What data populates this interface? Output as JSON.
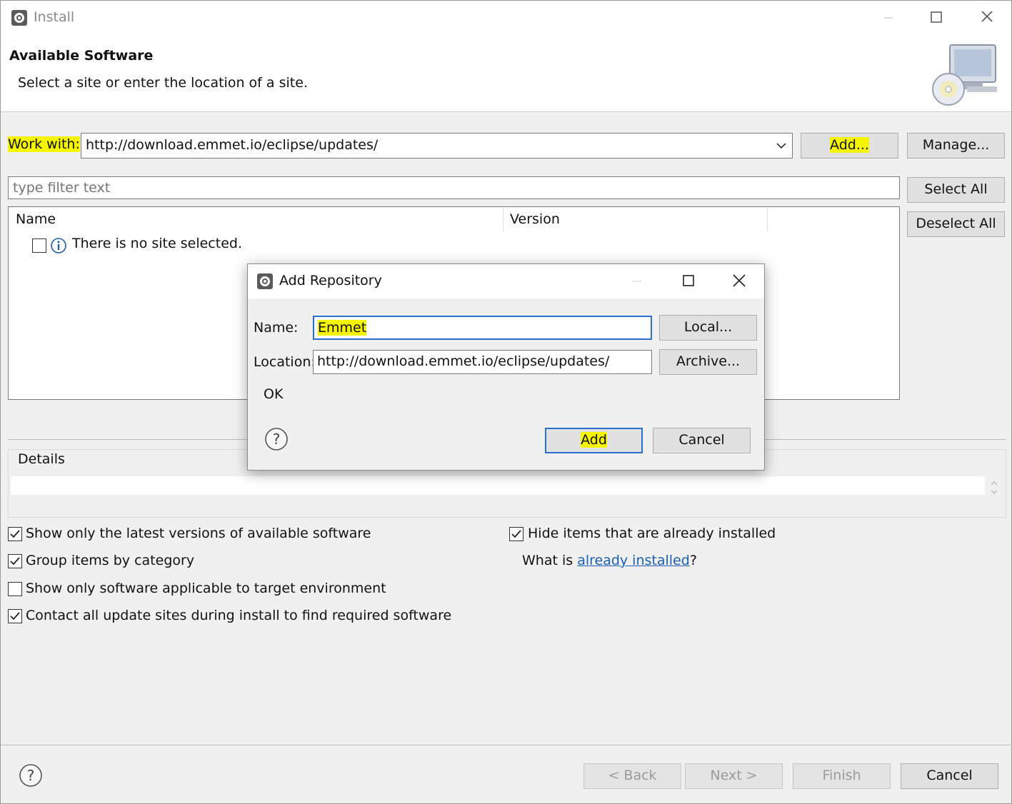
{
  "window": {
    "title": "Install"
  },
  "banner": {
    "title": "Available Software",
    "description": "Select a site or enter the location of a site."
  },
  "work_with": {
    "label": "Work with:",
    "value": "http://download.emmet.io/eclipse/updates/",
    "add_label": "Add...",
    "manage_label": "Manage..."
  },
  "filter": {
    "placeholder": "type filter text",
    "select_all_label": "Select All",
    "deselect_all_label": "Deselect All"
  },
  "tree": {
    "columns": [
      "Name",
      "Version"
    ],
    "empty_message": "There is no site selected."
  },
  "details": {
    "label": "Details"
  },
  "options": {
    "show_latest": {
      "label": "Show only the latest versions of available software",
      "checked": true
    },
    "group_by_category": {
      "label": "Group items by category",
      "checked": true
    },
    "show_applicable": {
      "label": "Show only software applicable to target environment",
      "checked": false
    },
    "contact_all_sites": {
      "label": "Contact all update sites during install to find required software",
      "checked": true
    },
    "hide_installed": {
      "label": "Hide items that are already installed",
      "checked": true
    },
    "what_is_prefix": "What is ",
    "already_installed_link": "already installed",
    "what_is_suffix": "?"
  },
  "footer": {
    "back_label": "< Back",
    "next_label": "Next >",
    "finish_label": "Finish",
    "cancel_label": "Cancel"
  },
  "add_repository": {
    "title": "Add Repository",
    "name_label": "Name:",
    "name_value": "Emmet",
    "location_label": "Location:",
    "location_value": "http://download.emmet.io/eclipse/updates/",
    "local_label": "Local...",
    "archive_label": "Archive...",
    "status": "OK",
    "add_label": "Add",
    "cancel_label": "Cancel"
  },
  "colors": {
    "highlight": "#f5f500",
    "link": "#1a5fb4",
    "default_button_border": "#2a6fd0"
  }
}
